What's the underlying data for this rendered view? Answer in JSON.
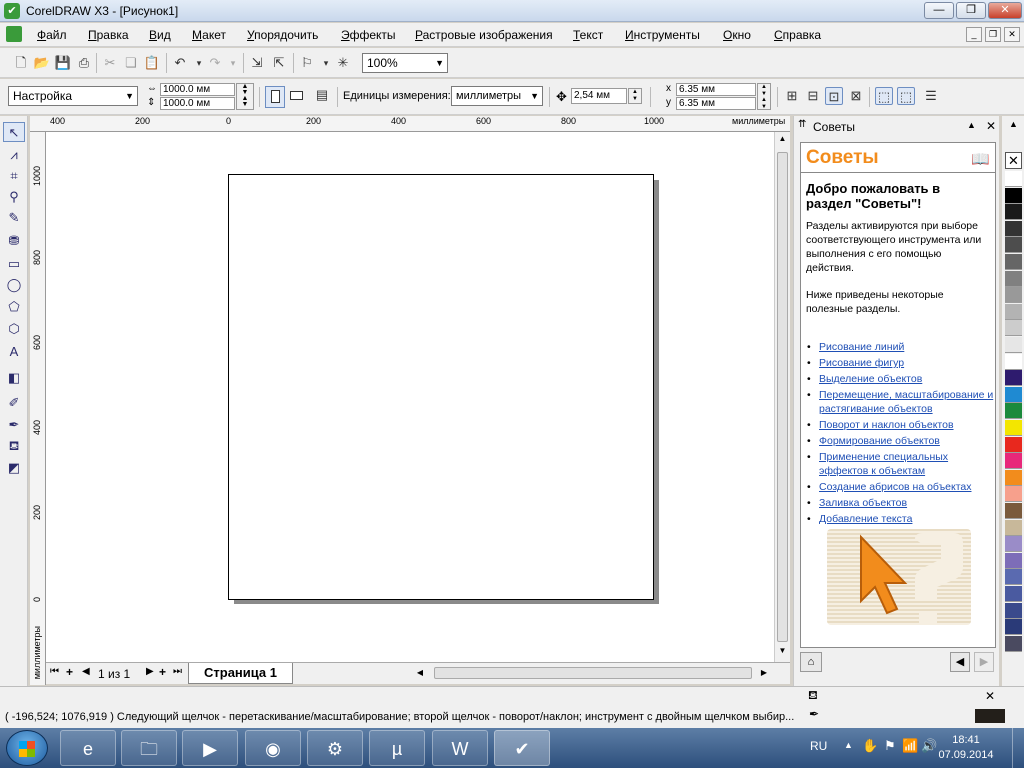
{
  "window": {
    "title": "CorelDRAW X3 - [Рисунок1]",
    "buttons": {
      "minimize": "—",
      "maximize": "❐",
      "close": "✕"
    }
  },
  "menu": [
    "Файл",
    "Правка",
    "Вид",
    "Макет",
    "Упорядочить",
    "Эффекты",
    "Растровые изображения",
    "Текст",
    "Инструменты",
    "Окно",
    "Справка"
  ],
  "toolbar": {
    "zoom": "100%"
  },
  "property_bar": {
    "preset": "Настройка",
    "width": "1000.0 мм",
    "height": "1000.0 мм",
    "units_label": "Единицы измерения:",
    "units_value": "миллиметры",
    "nudge": "2,54 мм",
    "dup_x_label": "x",
    "dup_x": "6.35 мм",
    "dup_y_label": "y",
    "dup_y": "6.35 мм"
  },
  "rulers": {
    "h_ticks": [
      "400",
      "200",
      "0",
      "200",
      "400",
      "600",
      "800",
      "1000"
    ],
    "h_unit": "миллиметры",
    "v_ticks": [
      "1000",
      "800",
      "600",
      "400",
      "200",
      "0"
    ],
    "v_unit": "миллиметры"
  },
  "page_nav": {
    "counter": "1 из 1",
    "tab": "Страница 1"
  },
  "docker": {
    "header": "Советы",
    "title": "Советы",
    "welcome": "Добро пожаловать в раздел \"Советы\"!",
    "intro": "Разделы активируются при выборе соответствующего инструмента или выполнения с его помощью действия.",
    "list_intro": "Ниже приведены некоторые полезные разделы.",
    "links": [
      "Рисование линий",
      "Рисование фигур",
      "Выделение объектов",
      "Перемещение, масштабирование и растягивание объектов",
      "Поворот и наклон объектов",
      "Формирование объектов",
      "Применение специальных эффектов к объектам",
      "Создание абрисов на объектах",
      "Заливка объектов",
      "Добавление текста"
    ]
  },
  "palette": [
    "#ffffff",
    "#000000",
    "#1a1a1a",
    "#333333",
    "#4d4d4d",
    "#666666",
    "#808080",
    "#999999",
    "#b3b3b3",
    "#cccccc",
    "#e6e6e6",
    "#ffffff",
    "#2e1b6e",
    "#1f8ad2",
    "#1b8a3c",
    "#f3e600",
    "#e8281e",
    "#e8287a",
    "#f28c1c",
    "#f7a08c",
    "#7a5a3c",
    "#c8b89a",
    "#9a8cc8",
    "#7d6db8",
    "#5a6ab0",
    "#4a5aa0",
    "#3a4a8c",
    "#2a3a78",
    "#4a4a60"
  ],
  "status": {
    "text": "( -196,524; 1076,919 )  Следующий щелчок - перетаскивание/масштабирование; второй щелчок - поворот/наклон; инструмент с двойным щелчком выбир..."
  },
  "taskbar": {
    "lang": "RU",
    "time": "18:41",
    "date": "07.09.2014"
  }
}
